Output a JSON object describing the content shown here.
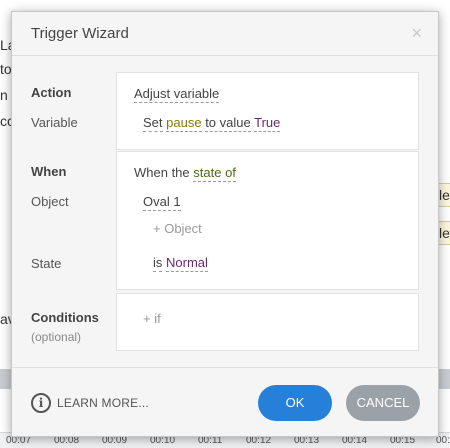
{
  "background": {
    "left_fragments": [
      "La",
      "to",
      "n",
      "cc",
      "av"
    ],
    "right_fragments": [
      "le",
      "le"
    ],
    "timeline_ticks": [
      "00:07",
      "00:08",
      "00:09",
      "00:10",
      "00:11",
      "00:12",
      "00:13",
      "00:14",
      "00:15",
      "00:1"
    ]
  },
  "dialog": {
    "title": "Trigger Wizard",
    "close_icon": "×",
    "action": {
      "label": "Action",
      "value": "Adjust variable",
      "variable_label": "Variable",
      "variable_prefix": "Set",
      "variable_name": "pause",
      "variable_mid": "to value",
      "variable_value": "True"
    },
    "when": {
      "label": "When",
      "prefix": "When the",
      "condition": "state of",
      "object_label": "Object",
      "object_value": "Oval 1",
      "add_object": "+ Object",
      "state_label": "State",
      "state_prefix": "is",
      "state_value": "Normal"
    },
    "conditions": {
      "label": "Conditions",
      "sublabel": "(optional)",
      "add_if": "+ if"
    },
    "footer": {
      "info_icon": "i",
      "learn_more": "LEARN MORE...",
      "ok": "OK",
      "cancel": "CANCEL"
    }
  },
  "colors": {
    "primary_button": "#2680d9",
    "cancel_button": "#9aa1a7",
    "variable_name": "#8a7a00",
    "variable_value": "#6b2a6b"
  }
}
